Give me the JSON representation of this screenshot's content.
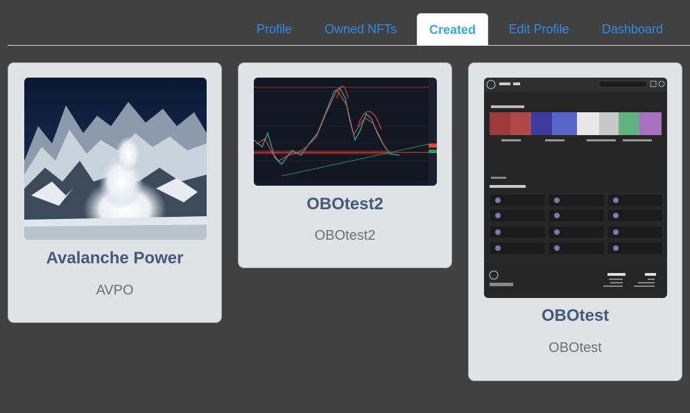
{
  "tabs": [
    {
      "label": "Profile",
      "active": false
    },
    {
      "label": "Owned NFTs",
      "active": false
    },
    {
      "label": "Created",
      "active": true
    },
    {
      "label": "Edit Profile",
      "active": false
    },
    {
      "label": "Dashboard",
      "active": false
    }
  ],
  "cards": [
    {
      "title": "Avalanche Power",
      "symbol": "AVPO",
      "image": "avalanche-mountain-photo"
    },
    {
      "title": "OBOtest2",
      "symbol": "OBOtest2",
      "image": "trading-chart-screenshot"
    },
    {
      "title": "OBOtest",
      "symbol": "OBOtest",
      "image": "marketplace-website-screenshot"
    }
  ],
  "colors": {
    "background": "#414141",
    "card": "#dfe3e6",
    "tab_link": "#2f8be6",
    "tab_active": "#38a7ea",
    "title": "#435a7d",
    "symbol": "#6c7074"
  }
}
